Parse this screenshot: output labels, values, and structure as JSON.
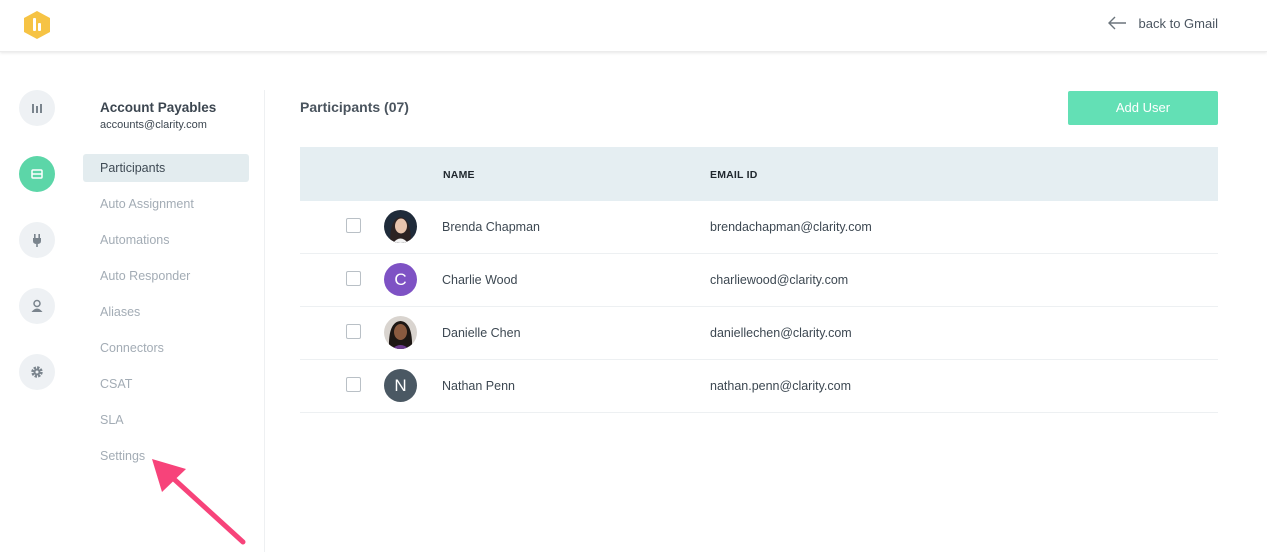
{
  "header": {
    "back_label": "back to Gmail"
  },
  "account": {
    "name": "Account Payables",
    "email": "accounts@clarity.com"
  },
  "subnav": {
    "items": [
      {
        "label": "Participants",
        "active": true
      },
      {
        "label": "Auto Assignment"
      },
      {
        "label": "Automations"
      },
      {
        "label": "Auto Responder"
      },
      {
        "label": "Aliases"
      },
      {
        "label": "Connectors"
      },
      {
        "label": "CSAT"
      },
      {
        "label": "SLA"
      },
      {
        "label": "Settings"
      }
    ]
  },
  "main": {
    "title": "Participants (07)",
    "add_button": "Add User",
    "columns": {
      "name": "NAME",
      "email": "EMAIL ID"
    },
    "rows": [
      {
        "name": "Brenda Chapman",
        "email": "brendachapman@clarity.com",
        "avatar": "photo"
      },
      {
        "name": "Charlie Wood",
        "email": "charliewood@clarity.com",
        "avatar": "C",
        "color": "#7e52c4"
      },
      {
        "name": "Danielle Chen",
        "email": "daniellechen@clarity.com",
        "avatar": "photo"
      },
      {
        "name": "Nathan Penn",
        "email": "nathan.penn@clarity.com",
        "avatar": "N",
        "color": "#4a5863"
      }
    ]
  },
  "colors": {
    "accent": "#5cd6a8",
    "button": "#63e0b5",
    "logo": "#f6c344",
    "annotation": "#f7437a"
  }
}
